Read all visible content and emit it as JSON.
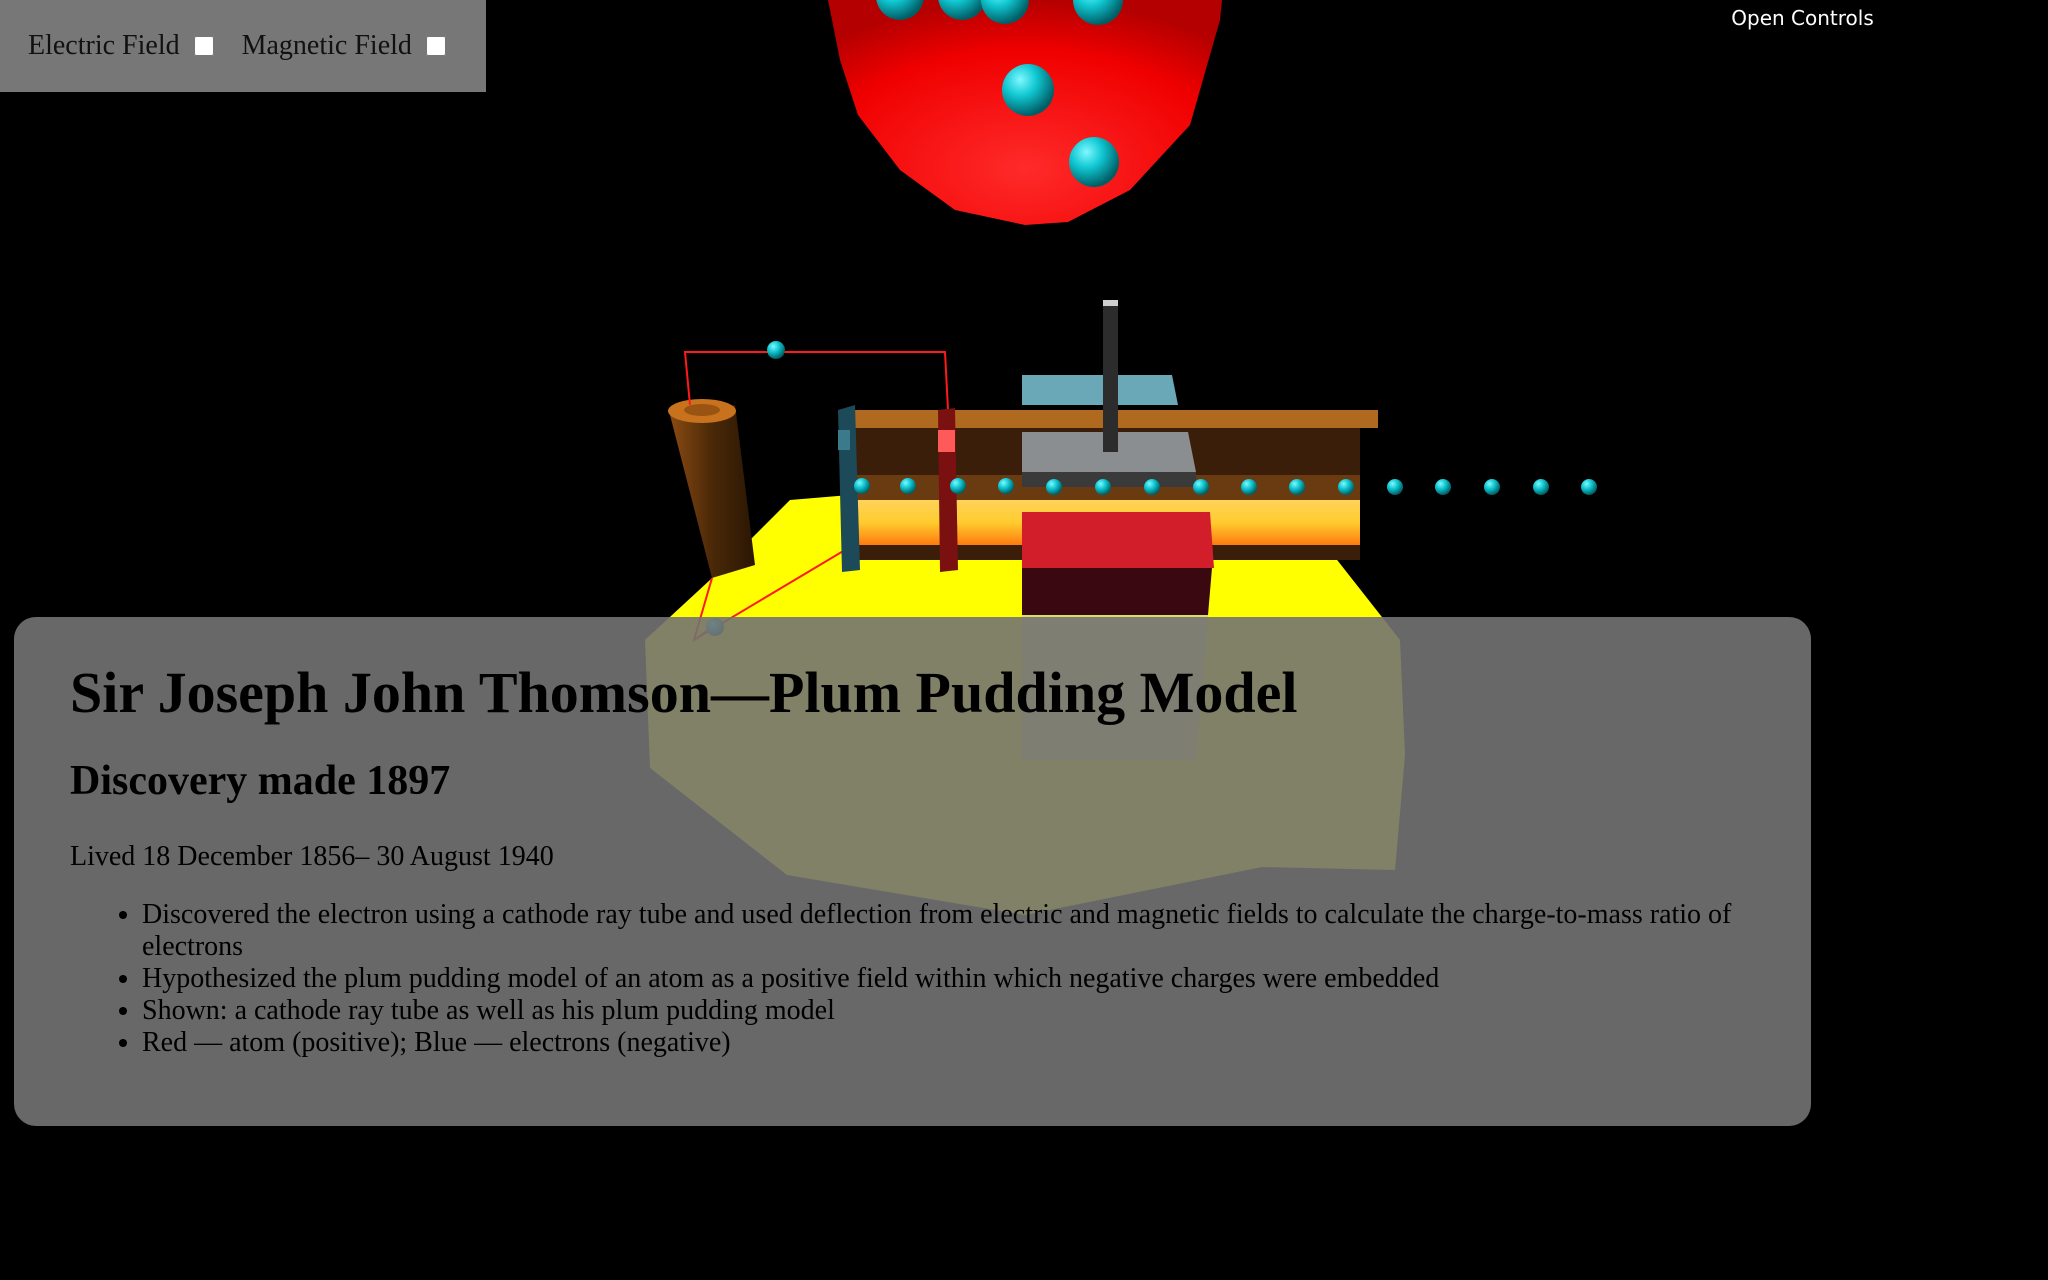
{
  "toggles": {
    "electric_label": "Electric Field",
    "electric_checked": false,
    "magnetic_label": "Magnetic Field",
    "magnetic_checked": false
  },
  "controls": {
    "open_label": "Open Controls"
  },
  "info": {
    "title": "Sir Joseph John Thomson—Plum Pudding Model",
    "subtitle": "Discovery made 1897",
    "lived": "Lived 18 December 1856– 30 August 1940",
    "bullets": [
      "Discovered the electron using a cathode ray tube and used deflection from electric and magnetic fields to calculate the charge-to-mass ratio of electrons",
      "Hypothesized the plum pudding model of an atom as a positive field within which negative charges were embedded",
      "Shown: a cathode ray tube as well as his plum pudding model",
      "Red — atom (positive); Blue — electrons (negative)"
    ]
  },
  "colors": {
    "background": "#000000",
    "atom_positive": "#ff0000",
    "electron_negative": "#00c8d0",
    "stage": "#ffff00",
    "panel": "#737373",
    "tube_wood": "#4a2808"
  }
}
